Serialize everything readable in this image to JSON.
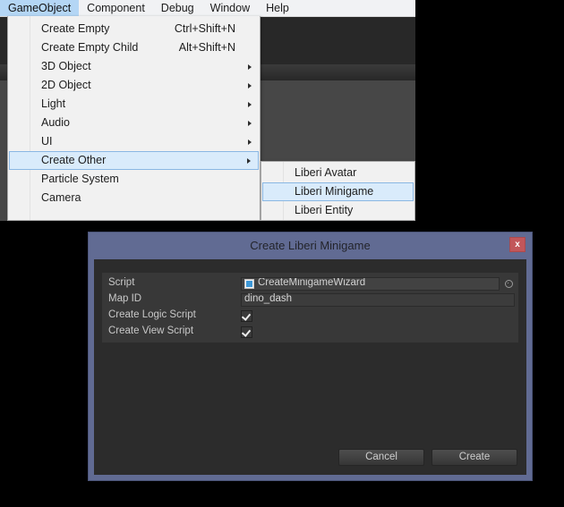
{
  "menubar": {
    "items": [
      {
        "label": "GameObject",
        "active": true
      },
      {
        "label": "Component",
        "active": false
      },
      {
        "label": "Debug",
        "active": false
      },
      {
        "label": "Window",
        "active": false
      },
      {
        "label": "Help",
        "active": false
      }
    ]
  },
  "gameobject_menu": {
    "items": [
      {
        "label": "Create Empty",
        "shortcut": "Ctrl+Shift+N",
        "arrow": false,
        "highlighted": false
      },
      {
        "label": "Create Empty Child",
        "shortcut": "Alt+Shift+N",
        "arrow": false,
        "highlighted": false
      },
      {
        "label": "3D Object",
        "shortcut": "",
        "arrow": true,
        "highlighted": false
      },
      {
        "label": "2D Object",
        "shortcut": "",
        "arrow": true,
        "highlighted": false
      },
      {
        "label": "Light",
        "shortcut": "",
        "arrow": true,
        "highlighted": false
      },
      {
        "label": "Audio",
        "shortcut": "",
        "arrow": true,
        "highlighted": false
      },
      {
        "label": "UI",
        "shortcut": "",
        "arrow": true,
        "highlighted": false
      },
      {
        "label": "Create Other",
        "shortcut": "",
        "arrow": true,
        "highlighted": true
      },
      {
        "label": "Particle System",
        "shortcut": "",
        "arrow": false,
        "highlighted": false
      },
      {
        "label": "Camera",
        "shortcut": "",
        "arrow": false,
        "highlighted": false
      }
    ]
  },
  "create_other_submenu": {
    "items": [
      {
        "label": "Liberi Avatar",
        "highlighted": false
      },
      {
        "label": "Liberi Minigame",
        "highlighted": true
      },
      {
        "label": "Liberi Entity",
        "highlighted": false
      }
    ]
  },
  "dialog": {
    "title": "Create Liberi Minigame",
    "close_label": "x",
    "fields": [
      {
        "label": "Script",
        "type": "object",
        "value": "CreateMinigameWizard",
        "icon": "cs-script-icon"
      },
      {
        "label": "Map ID",
        "type": "text",
        "value": "dino_dash"
      },
      {
        "label": "Create Logic Script",
        "type": "checkbox",
        "checked": true
      },
      {
        "label": "Create View Script",
        "type": "checkbox",
        "checked": true
      }
    ],
    "buttons": [
      {
        "label": "Cancel"
      },
      {
        "label": "Create"
      }
    ]
  },
  "colors": {
    "menu_background": "#f1f1f1",
    "menu_highlight": "#d9ebfb",
    "menubar_active": "#b4d6f5",
    "dialog_chrome": "#616b93",
    "dialog_body": "#2c2c2c",
    "form_panel": "#383838",
    "close_button": "#c2565a",
    "editor_dark": "#282828",
    "editor_light": "#474747"
  }
}
